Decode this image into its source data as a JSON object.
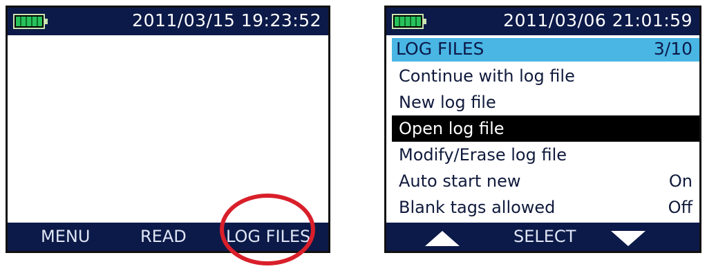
{
  "screen1": {
    "datetime": "2011/03/15   19:23:52",
    "softkeys": [
      "MENU",
      "READ",
      "LOG FILES"
    ]
  },
  "screen2": {
    "datetime": "2011/03/06   21:01:59",
    "header": {
      "title": "LOG FILES",
      "count": "3/10"
    },
    "items": [
      {
        "label": "Continue with log file",
        "value": ""
      },
      {
        "label": "New log file",
        "value": ""
      },
      {
        "label": "Open log file",
        "value": "",
        "selected": true
      },
      {
        "label": "Modify/Erase log file",
        "value": ""
      },
      {
        "label": "Auto start new",
        "value": "On"
      },
      {
        "label": "Blank tags allowed",
        "value": "Off"
      }
    ],
    "softkeys": {
      "left_icon": "arrow-up-icon",
      "center": "SELECT",
      "right_icon": "arrow-down-icon"
    }
  },
  "colors": {
    "bar": "#0c1a49",
    "highlight": "#49b6e4",
    "annotation": "#d91f2a",
    "battery": "#27c25a"
  }
}
